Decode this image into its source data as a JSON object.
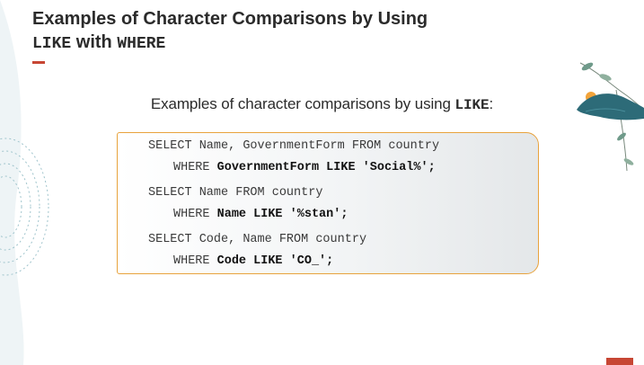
{
  "title": {
    "part1": "Examples of Character Comparisons by Using",
    "keyword1": "LIKE",
    "part2": "with",
    "keyword2": "WHERE"
  },
  "subtitle": {
    "text": "Examples of character comparisons by using",
    "keyword": "LIKE",
    "suffix": ":"
  },
  "code": [
    {
      "select": "SELECT Name, GovernmentForm FROM country",
      "where_kw": "WHERE",
      "where_cond": "GovernmentForm LIKE 'Social%';"
    },
    {
      "select": "SELECT Name FROM country",
      "where_kw": "WHERE",
      "where_cond": "Name LIKE '%stan';"
    },
    {
      "select": "SELECT Code, Name FROM country",
      "where_kw": "WHERE",
      "where_cond": "Code LIKE 'CO_';"
    }
  ],
  "colors": {
    "accent": "#c74634",
    "box_border": "#e8a33d",
    "title_text": "#2b2b2b",
    "bird_teal": "#2d6b78",
    "sun_orange": "#f2a33a"
  },
  "icons": [
    "ripple-decoration",
    "bird-branch-illustration"
  ]
}
